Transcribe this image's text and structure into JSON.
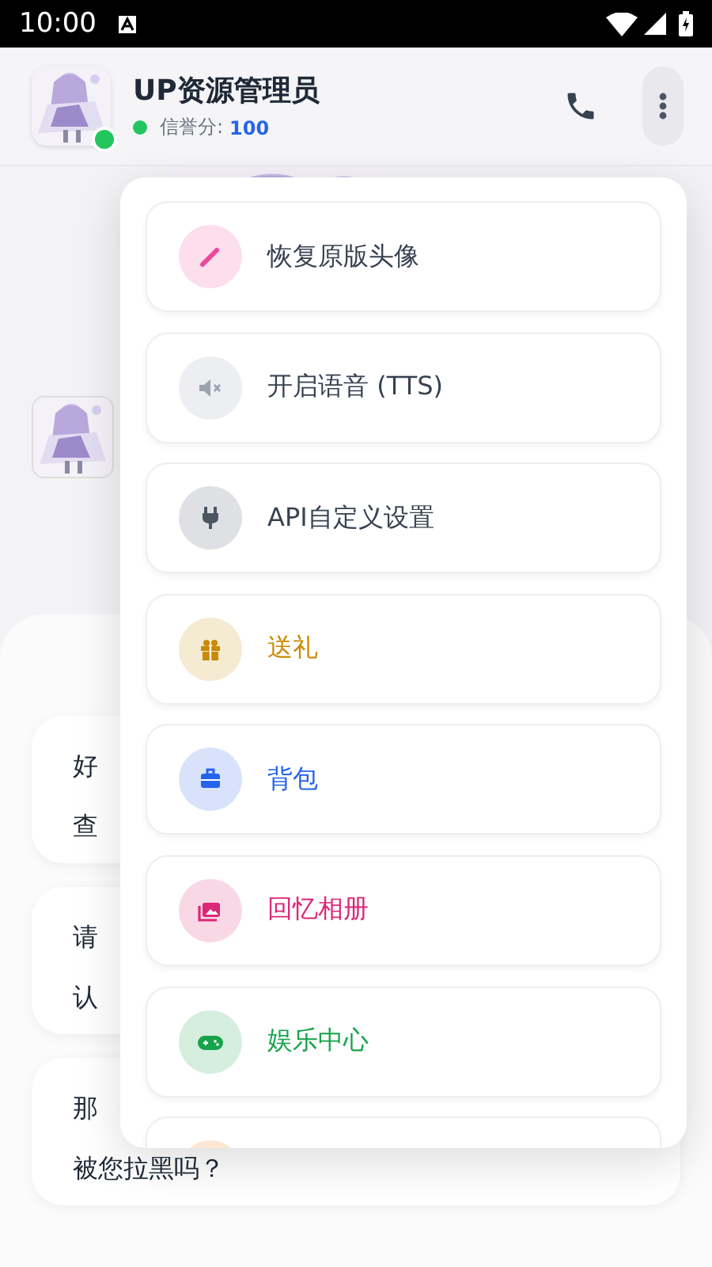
{
  "status_bar": {
    "time": "10:00"
  },
  "header": {
    "name": "UP资源管理员",
    "online": true,
    "credit_label": "信誉分:",
    "credit_value": "100"
  },
  "chat": {
    "messages": [
      {
        "lines": [
          "好",
          "查"
        ]
      },
      {
        "lines": [
          "请",
          "认"
        ]
      },
      {
        "lines": [
          "那",
          "被您拉黑吗？"
        ]
      }
    ]
  },
  "menu": {
    "items": [
      {
        "kind": "pen",
        "label": "恢复原版头像",
        "color": "#ec4899",
        "tinted": false
      },
      {
        "kind": "mute",
        "label": "开启语音 (TTS)",
        "color": "#9ca3af",
        "tinted": false
      },
      {
        "kind": "plug",
        "label": "API自定义设置",
        "color": "#4b5563",
        "tinted": false
      },
      {
        "kind": "gift",
        "label": "送礼",
        "color": "#ca8a04",
        "tinted": true
      },
      {
        "kind": "bag",
        "label": "背包",
        "color": "#2563eb",
        "tinted": true
      },
      {
        "kind": "album",
        "label": "回忆相册",
        "color": "#db2777",
        "tinted": true
      },
      {
        "kind": "game",
        "label": "娱乐中心",
        "color": "#16a34a",
        "tinted": true
      },
      {
        "kind": "partial"
      }
    ]
  }
}
